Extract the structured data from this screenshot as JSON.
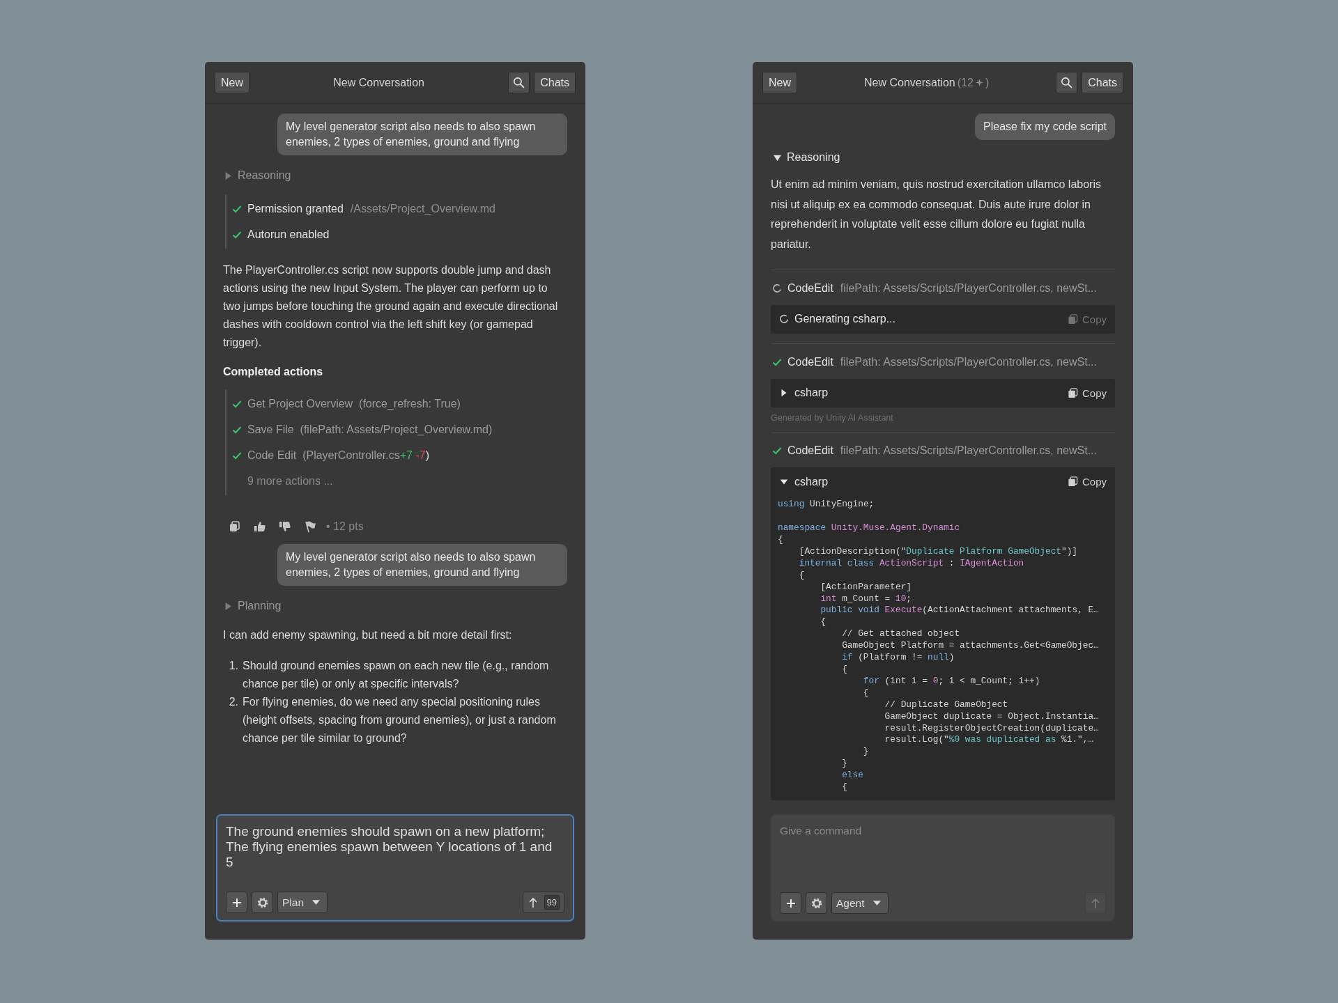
{
  "panels": [
    {
      "header": {
        "new_button": "New",
        "title": "New Conversation",
        "chats_button": "Chats"
      },
      "messages": [
        {
          "kind": "user",
          "text": "My level generator script also needs to also spawn enemies, 2 types of enemies, ground and flying"
        },
        {
          "kind": "toggle",
          "label": "Reasoning",
          "expanded": false
        },
        {
          "kind": "status_list",
          "items": [
            {
              "label": "Permission granted",
              "detail": "/Assets/Project_Overview.md"
            },
            {
              "label": "Autorun enabled"
            }
          ]
        },
        {
          "kind": "paragraph",
          "text": "The PlayerController.cs script now supports double jump and dash actions using the new Input System. The player can perform up to two jumps before touching the ground again and execute directional dashes with cooldown control via the left shift key (or gamepad trigger)."
        },
        {
          "kind": "heading",
          "text": "Completed actions"
        },
        {
          "kind": "action_list",
          "items": [
            {
              "kind": "action",
              "name": "Get Project Overview",
              "args": "(force_refresh: True)"
            },
            {
              "kind": "action",
              "name": "Save File",
              "args": "(filePath: Assets/Project_Overview.md)"
            },
            {
              "kind": "action",
              "name": "Code Edit",
              "args": "(PlayerController.cs",
              "added": "+7",
              "removed": "-7",
              "close": ")"
            },
            {
              "kind": "more",
              "text": "9 more actions ..."
            }
          ]
        },
        {
          "kind": "feedback",
          "points": "• 12 pts"
        },
        {
          "kind": "user",
          "text": "My level generator script also needs to also spawn enemies, 2 types of enemies, ground and flying"
        },
        {
          "kind": "toggle",
          "label": "Planning",
          "expanded": false
        },
        {
          "kind": "paragraph",
          "text": "I can add enemy spawning, but need a bit more detail first:"
        },
        {
          "kind": "ordered",
          "items": [
            {
              "number": "1.",
              "text": "Should ground enemies spawn on each new tile (e.g., random chance per tile) or only at specific intervals?"
            },
            {
              "number": "2.",
              "text": "For flying enemies, do we need any special positioning rules (height offsets, spacing from ground enemies), or just a random chance per tile similar to ground?"
            }
          ]
        }
      ],
      "composer": {
        "focused": true,
        "value": "The ground enemies should spawn on a new platform; The flying enemies spawn between Y locations of 1 and 5",
        "mode": "Plan",
        "send": {
          "enabled": true,
          "count": "99"
        }
      }
    },
    {
      "header": {
        "new_button": "New",
        "title": "New Conversation",
        "badge": {
          "open": "(12",
          "close": ")"
        },
        "chats_button": "Chats"
      },
      "messages": [
        {
          "kind": "user",
          "text": "Please fix my code script"
        },
        {
          "kind": "toggle",
          "label": "Reasoning",
          "expanded": true
        },
        {
          "kind": "paragraph",
          "text": "Ut enim ad minim veniam, quis nostrud exercitation ullamco laboris nisi ut aliquip ex ea commodo consequat. Duis aute irure dolor in reprehenderit in voluptate velit esse cillum dolore eu fugiat nulla pariatur."
        },
        {
          "kind": "divider"
        },
        {
          "kind": "tool",
          "done": false,
          "name": "CodeEdit",
          "args": "filePath: Assets/Scripts/PlayerController.cs, newSt..."
        },
        {
          "kind": "code_block",
          "generating": true,
          "label": "Generating csharp...",
          "copy": "Copy",
          "copy_enabled": false
        },
        {
          "kind": "divider"
        },
        {
          "kind": "tool",
          "done": true,
          "name": "CodeEdit",
          "args": "filePath: Assets/Scripts/PlayerController.cs, newSt..."
        },
        {
          "kind": "code_block",
          "generating": false,
          "expanded": false,
          "label": "csharp",
          "copy": "Copy",
          "copy_enabled": true
        },
        {
          "kind": "note",
          "text": "Generated by Unity AI Assistant"
        },
        {
          "kind": "divider"
        },
        {
          "kind": "tool",
          "done": true,
          "name": "CodeEdit",
          "args": "filePath: Assets/Scripts/PlayerController.cs, newSt..."
        },
        {
          "kind": "code_block",
          "generating": false,
          "expanded": true,
          "label": "csharp",
          "copy": "Copy",
          "copy_enabled": true,
          "lines": [
            {
              "tokens": [
                {
                  "kind": "kw",
                  "text": "using"
                },
                {
                  "kind": "plain",
                  "text": " UnityEngine;"
                }
              ]
            },
            {
              "kind": "blank"
            },
            {
              "tokens": [
                {
                  "kind": "kw",
                  "text": "namespace "
                },
                {
                  "kind": "type",
                  "text": "Unity.Muse.Agent.Dynamic"
                }
              ]
            },
            {
              "tokens": [
                {
                  "kind": "plain",
                  "text": "{"
                }
              ]
            },
            {
              "tokens": [
                {
                  "kind": "plain",
                  "text": "    [ActionDescription(\""
                },
                {
                  "kind": "str",
                  "text": "Duplicate Platform GameObject"
                },
                {
                  "kind": "plain",
                  "text": "\")]"
                }
              ]
            },
            {
              "tokens": [
                {
                  "kind": "kw",
                  "text": "    internal class "
                },
                {
                  "kind": "type",
                  "text": "ActionScript"
                },
                {
                  "kind": "plain",
                  "text": " : "
                },
                {
                  "kind": "type",
                  "text": "IAgentAction"
                }
              ]
            },
            {
              "tokens": [
                {
                  "kind": "plain",
                  "text": "    {"
                }
              ]
            },
            {
              "tokens": [
                {
                  "kind": "plain",
                  "text": "        [ActionParameter]"
                }
              ]
            },
            {
              "tokens": [
                {
                  "kind": "type",
                  "text": "        int"
                },
                {
                  "kind": "plain",
                  "text": " m_Count = "
                },
                {
                  "kind": "num",
                  "text": "10"
                },
                {
                  "kind": "plain",
                  "text": ";"
                }
              ]
            },
            {
              "tokens": [
                {
                  "kind": "kw",
                  "text": "        public void "
                },
                {
                  "kind": "type",
                  "text": "Execute"
                },
                {
                  "kind": "plain",
                  "text": "(ActionAttachment attachments, E…"
                }
              ]
            },
            {
              "tokens": [
                {
                  "kind": "plain",
                  "text": "        {"
                }
              ]
            },
            {
              "tokens": [
                {
                  "kind": "plain",
                  "text": "            // Get attached object"
                }
              ]
            },
            {
              "tokens": [
                {
                  "kind": "plain",
                  "text": "            GameObject Platform = attachments.Get<GameObjec…"
                }
              ]
            },
            {
              "tokens": [
                {
                  "kind": "kw",
                  "text": "            if"
                },
                {
                  "kind": "plain",
                  "text": " (Platform != "
                },
                {
                  "kind": "kw",
                  "text": "null"
                },
                {
                  "kind": "plain",
                  "text": ")"
                }
              ]
            },
            {
              "tokens": [
                {
                  "kind": "plain",
                  "text": "            {"
                }
              ]
            },
            {
              "tokens": [
                {
                  "kind": "kw",
                  "text": "                for"
                },
                {
                  "kind": "plain",
                  "text": " (int i = "
                },
                {
                  "kind": "num",
                  "text": "0"
                },
                {
                  "kind": "plain",
                  "text": "; i < m_Count; i++)"
                }
              ]
            },
            {
              "tokens": [
                {
                  "kind": "plain",
                  "text": "                {"
                }
              ]
            },
            {
              "tokens": [
                {
                  "kind": "plain",
                  "text": "                    // Duplicate GameObject"
                }
              ]
            },
            {
              "tokens": [
                {
                  "kind": "plain",
                  "text": "                    GameObject duplicate = Object.Instantia…"
                }
              ]
            },
            {
              "tokens": [
                {
                  "kind": "plain",
                  "text": "                    result.RegisterObjectCreation(duplicate…"
                }
              ]
            },
            {
              "tokens": [
                {
                  "kind": "plain",
                  "text": "                    result.Log(\""
                },
                {
                  "kind": "str",
                  "text": "%0 was duplicated as"
                },
                {
                  "kind": "plain",
                  "text": " %1.\",…"
                }
              ]
            },
            {
              "tokens": [
                {
                  "kind": "plain",
                  "text": "                }"
                }
              ]
            },
            {
              "tokens": [
                {
                  "kind": "plain",
                  "text": "            }"
                }
              ]
            },
            {
              "tokens": [
                {
                  "kind": "kw",
                  "text": "            else"
                }
              ]
            },
            {
              "tokens": [
                {
                  "kind": "plain",
                  "text": "            {"
                }
              ]
            }
          ]
        }
      ],
      "composer": {
        "focused": false,
        "placeholder": "Give a command",
        "mode": "Agent",
        "send": {
          "enabled": false
        }
      }
    }
  ]
}
